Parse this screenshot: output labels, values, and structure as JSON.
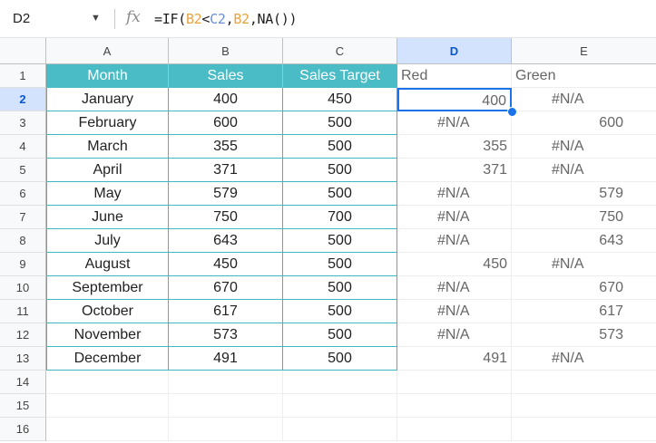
{
  "formula_bar": {
    "name_box": "D2",
    "formula_prefix": "=IF(",
    "ref_a": "B2",
    "lt": "<",
    "ref_b": "C2",
    "comma1": ",",
    "ref_c": "B2",
    "formula_suffix": ",NA())"
  },
  "columns": [
    "A",
    "B",
    "C",
    "D",
    "E"
  ],
  "rows": [
    "1",
    "2",
    "3",
    "4",
    "5",
    "6",
    "7",
    "8",
    "9",
    "10",
    "11",
    "12",
    "13",
    "14",
    "15",
    "16"
  ],
  "header": {
    "month": "Month",
    "sales": "Sales",
    "target": "Sales Target",
    "red": "Red",
    "green": "Green"
  },
  "table": [
    {
      "month": "January",
      "sales": "400",
      "target": "450",
      "red": "400",
      "green": "#N/A"
    },
    {
      "month": "February",
      "sales": "600",
      "target": "500",
      "red": "#N/A",
      "green": "600"
    },
    {
      "month": "March",
      "sales": "355",
      "target": "500",
      "red": "355",
      "green": "#N/A"
    },
    {
      "month": "April",
      "sales": "371",
      "target": "500",
      "red": "371",
      "green": "#N/A"
    },
    {
      "month": "May",
      "sales": "579",
      "target": "500",
      "red": "#N/A",
      "green": "579"
    },
    {
      "month": "June",
      "sales": "750",
      "target": "700",
      "red": "#N/A",
      "green": "750"
    },
    {
      "month": "July",
      "sales": "643",
      "target": "500",
      "red": "#N/A",
      "green": "643"
    },
    {
      "month": "August",
      "sales": "450",
      "target": "500",
      "red": "450",
      "green": "#N/A"
    },
    {
      "month": "September",
      "sales": "670",
      "target": "500",
      "red": "#N/A",
      "green": "670"
    },
    {
      "month": "October",
      "sales": "617",
      "target": "500",
      "red": "#N/A",
      "green": "617"
    },
    {
      "month": "November",
      "sales": "573",
      "target": "500",
      "red": "#N/A",
      "green": "573"
    },
    {
      "month": "December",
      "sales": "491",
      "target": "500",
      "red": "491",
      "green": "#N/A"
    }
  ],
  "selection": {
    "cell": "D2"
  },
  "colors": {
    "table_header": "#49bcc5",
    "table_border": "#3eb7c0",
    "selection": "#1a73e8"
  }
}
